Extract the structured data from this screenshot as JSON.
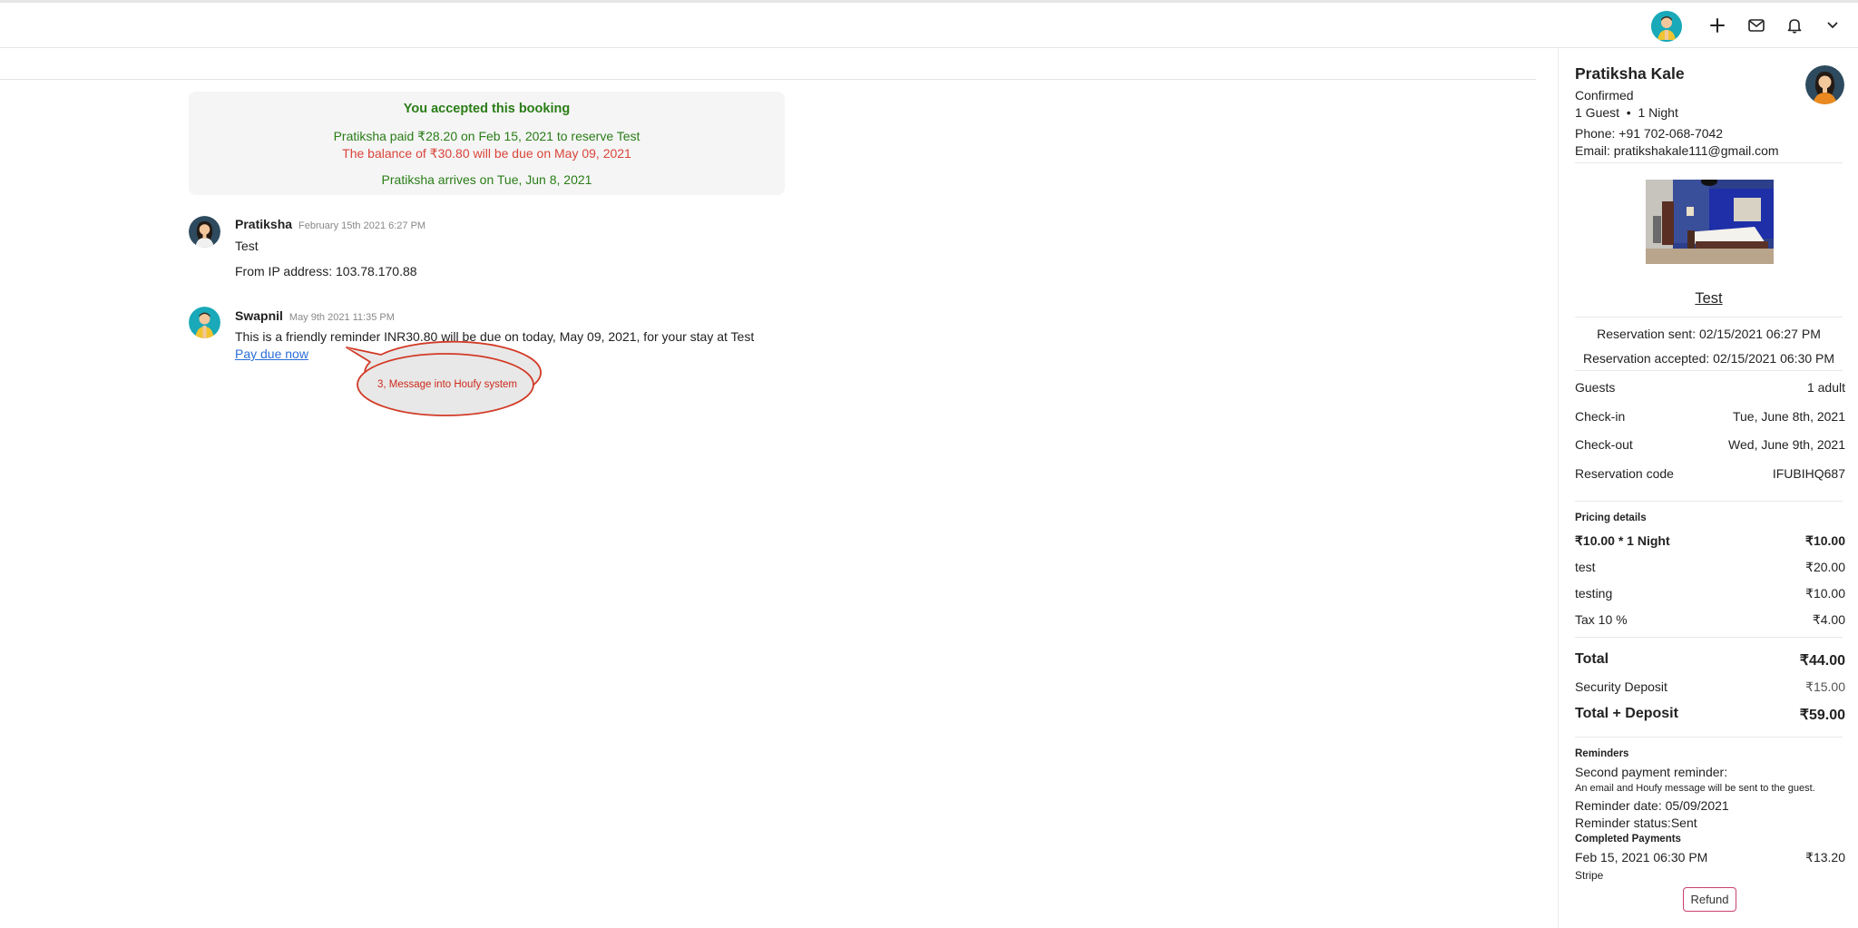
{
  "booking_card": {
    "title": "You accepted this booking",
    "paid_line": "Pratiksha paid ₹28.20 on Feb 15, 2021 to reserve Test",
    "balance_line": "The balance of ₹30.80 will be due on May 09, 2021",
    "arrival_line": "Pratiksha arrives on Tue, Jun 8, 2021"
  },
  "messages": [
    {
      "sender": "Pratiksha",
      "time": "February 15th 2021 6:27 PM",
      "lines": [
        "Test",
        "From IP address: 103.78.170.88"
      ]
    },
    {
      "sender": "Swapnil",
      "time": "May 9th 2021 11:35 PM",
      "text": "This is a friendly reminder INR30.80 will be due on today, May 09, 2021, for your stay at Test",
      "link": "Pay due now"
    }
  ],
  "callout": {
    "text": "3, Message into Houfy system"
  },
  "guest": {
    "name": "Pratiksha Kale",
    "status": "Confirmed",
    "guests_nights": "1 Guest  •  1 Night",
    "phone": "Phone: +91 702-068-7042",
    "email": "Email: pratikshakale111@gmail.com"
  },
  "listing": {
    "title": "Test",
    "reservation_sent": "Reservation sent: 02/15/2021 06:27 PM",
    "reservation_accepted": "Reservation accepted: 02/15/2021 06:30 PM"
  },
  "details": [
    {
      "label": "Guests",
      "value": "1 adult"
    },
    {
      "label": "Check-in",
      "value": "Tue, June 8th, 2021"
    },
    {
      "label": "Check-out",
      "value": "Wed, June 9th, 2021"
    },
    {
      "label": "Reservation code",
      "value": "IFUBIHQ687"
    }
  ],
  "pricing": {
    "heading": "Pricing details",
    "items": [
      {
        "label": "₹10.00 * 1 Night",
        "value": "₹10.00"
      },
      {
        "label": "test",
        "value": "₹20.00"
      },
      {
        "label": "testing",
        "value": "₹10.00"
      },
      {
        "label": "Tax 10 %",
        "value": "₹4.00"
      }
    ],
    "total_label": "Total",
    "total_value": "₹44.00",
    "deposit_label": "Security Deposit",
    "deposit_value": "₹15.00",
    "total_deposit_label": "Total + Deposit",
    "total_deposit_value": "₹59.00"
  },
  "reminders": {
    "heading": "Reminders",
    "name": "Second payment reminder:",
    "note": "An email and Houfy message will be sent to the guest.",
    "date": "Reminder date: 05/09/2021",
    "status": "Reminder status:Sent"
  },
  "completed_payments": {
    "heading": "Completed Payments",
    "date": "Feb 15, 2021 06:30 PM",
    "amount": "₹13.20",
    "method": "Stripe",
    "refund_label": "Refund"
  },
  "colors": {
    "accepted_green": "#2a7d17",
    "balance_red": "#d9453b",
    "link_blue": "#2b6fd6",
    "avatar_teal": "#19a9b8",
    "avatar_dark": "#2d4a5e"
  }
}
